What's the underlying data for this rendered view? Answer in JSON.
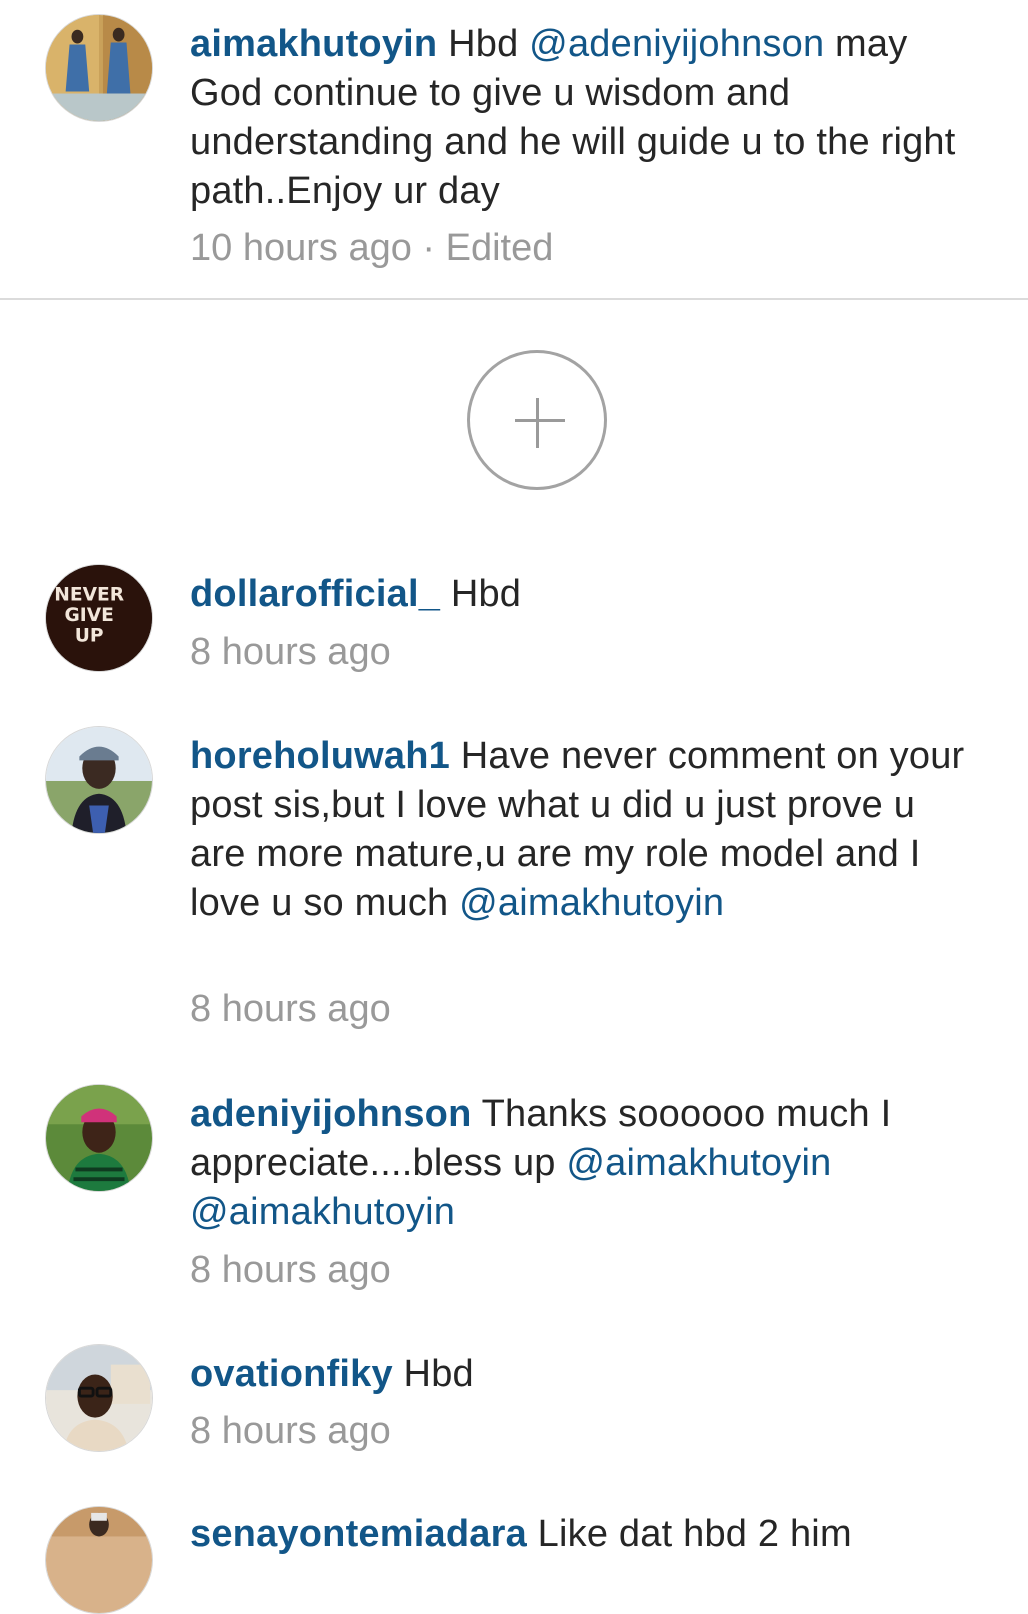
{
  "comments_top": [
    {
      "username": "aimakhutoyin",
      "parts": [
        {
          "type": "text",
          "value": " Hbd "
        },
        {
          "type": "mention",
          "value": "@adeniyijohnson"
        },
        {
          "type": "text",
          "value": " may God continue to give u wisdom and understanding and he will guide u to the right path..Enjoy ur day"
        }
      ],
      "time": "10 hours ago",
      "edited": " · Edited",
      "avatar_icon": "profile-photo-woman-blue-dress"
    }
  ],
  "load_more": {
    "icon": "plus-circle-icon"
  },
  "comments": [
    {
      "username": "dollarofficial_",
      "parts": [
        {
          "type": "text",
          "value": " Hbd"
        }
      ],
      "time": "8 hours ago",
      "avatar_icon": "never-give-up-sign",
      "avatar_text": [
        "NEVER",
        "GIVE",
        "UP"
      ]
    },
    {
      "username": "horeholuwah1",
      "parts": [
        {
          "type": "text",
          "value": " Have never comment on your post sis,but I love what u did u just prove u are more mature,u are my role model and I love u so much "
        },
        {
          "type": "mention",
          "value": "@aimakhutoyin"
        }
      ],
      "time": "8 hours ago",
      "avatar_icon": "profile-photo-woman-cap"
    },
    {
      "username": "adeniyijohnson",
      "parts": [
        {
          "type": "text",
          "value": " Thanks soooooo much I appreciate....bless up "
        },
        {
          "type": "mention",
          "value": "@aimakhutoyin"
        },
        {
          "type": "text",
          "value": " "
        },
        {
          "type": "mention",
          "value": "@aimakhutoyin"
        }
      ],
      "time": "8 hours ago",
      "avatar_icon": "profile-photo-man-green"
    },
    {
      "username": "ovationfiky",
      "parts": [
        {
          "type": "text",
          "value": " Hbd"
        }
      ],
      "time": "8 hours ago",
      "avatar_icon": "profile-photo-man-glasses"
    },
    {
      "username": "senayontemiadara",
      "parts": [
        {
          "type": "text",
          "value": " Like dat hbd 2 him"
        }
      ],
      "time": "",
      "avatar_icon": "profile-photo-child"
    }
  ],
  "colors": {
    "username": "#125688",
    "mention": "#125688",
    "body_text": "#262626",
    "meta_text": "#999999",
    "divider": "#dbdbdb"
  }
}
